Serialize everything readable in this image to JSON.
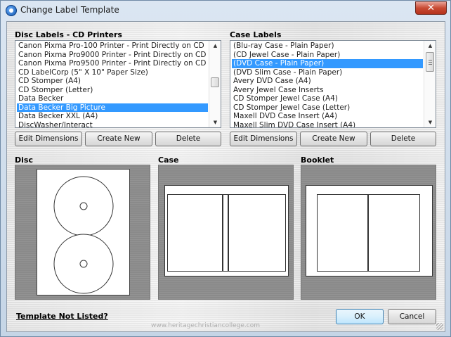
{
  "window": {
    "title": "Change Label Template",
    "close_glyph": "✕"
  },
  "disc_labels": {
    "heading": "Disc Labels - CD Printers",
    "items": [
      "Canon Pixma Pro-100 Printer - Print Directly on CD",
      "Canon Pixma Pro9000 Printer - Print Directly on CD",
      "Canon Pixma Pro9500 Printer - Print Directly on CD",
      "CD LabelCorp (5\" X 10\" Paper Size)",
      "CD Stomper (A4)",
      "CD Stomper (Letter)",
      "Data Becker",
      "Data Becker Big Picture",
      "Data Becker XXL (A4)",
      "DiscWasher/Interact"
    ],
    "selected_index": 7
  },
  "case_labels": {
    "heading": "Case Labels",
    "items": [
      "(Blu-ray Case - Plain Paper)",
      "(CD Jewel Case - Plain Paper)",
      "(DVD Case - Plain Paper)",
      "(DVD Slim Case - Plain Paper)",
      "Avery DVD Case (A4)",
      "Avery Jewel Case Inserts",
      "CD Stomper Jewel Case (A4)",
      "CD Stomper Jewel Case (Letter)",
      "Maxell DVD Case Insert (A4)",
      "Maxell Slim DVD Case Insert (A4)"
    ],
    "selected_index": 2
  },
  "buttons": {
    "edit_dimensions": "Edit Dimensions",
    "create_new": "Create New",
    "delete": "Delete",
    "ok": "OK",
    "cancel": "Cancel"
  },
  "previews": {
    "disc": "Disc",
    "case": "Case",
    "booklet": "Booklet"
  },
  "footer": {
    "link": "Template Not Listed?",
    "watermark": "www.heritagechristiancollege.com"
  },
  "icons": {
    "app": "disc-app-icon",
    "close": "close-icon",
    "scroll_up": "scroll-up-arrow-icon",
    "scroll_down": "scroll-down-arrow-icon"
  },
  "colors": {
    "selection": "#3399ff",
    "close_button": "#c84a33",
    "preview_bg": "#8a8a8a"
  }
}
